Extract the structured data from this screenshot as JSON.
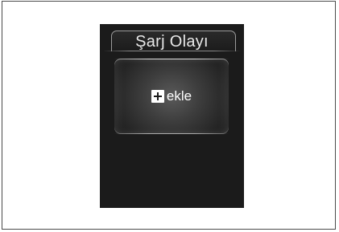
{
  "screen": {
    "title": "Şarj Olayı",
    "add_button": {
      "icon": "plus-square-icon",
      "label": "ekle"
    }
  },
  "colors": {
    "screen_background": "#1b1b1b",
    "text": "#ffffff",
    "outer_background": "#ffffff",
    "frame_border": "#4a4a4a"
  }
}
